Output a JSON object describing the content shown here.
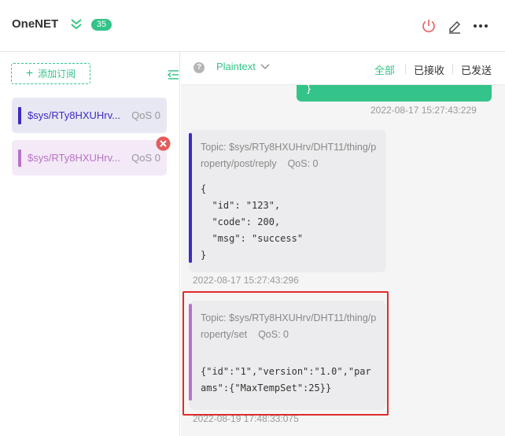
{
  "header": {
    "title": "OneNET",
    "connection_count": "35",
    "icons": [
      "collapse-icon",
      "power-icon",
      "edit-icon",
      "more-icon"
    ],
    "colors": {
      "accent": "#34c388",
      "danger": "#e55c5c"
    }
  },
  "sidebar": {
    "add_subscription_label": "添加订阅",
    "subscriptions": [
      {
        "topic": "$sys/RTy8HXUHrv...",
        "qos": "QoS 0",
        "color": "#3d2bc4"
      },
      {
        "topic": "$sys/RTy8HXUHrv...",
        "qos": "QoS 0",
        "color": "#b773c6"
      }
    ]
  },
  "toolbar": {
    "help": "?",
    "format": "Plaintext",
    "filters": {
      "all": "全部",
      "received": "已接收",
      "sent": "已发送"
    },
    "active_filter": "全部"
  },
  "messages": {
    "sent": {
      "payload": "}",
      "time": "2022-08-17 15:27:43:229"
    },
    "received": [
      {
        "topic": "Topic: $sys/RTy8HXUHrv/DHT11/thing/property/post/reply",
        "qos": "QoS: 0",
        "payload": "{\n  \"id\": \"123\",\n  \"code\": 200,\n  \"msg\": \"success\"\n}",
        "time": "2022-08-17 15:27:43:296",
        "color": "#3d2bc4"
      },
      {
        "topic": "Topic: $sys/RTy8HXUHrv/DHT11/thing/property/set",
        "qos": "QoS: 0",
        "payload": "{\"id\":\"1\",\"version\":\"1.0\",\"params\":{\"MaxTempSet\":25}}",
        "time": "2022-08-19 17:48:33:075",
        "color": "#b773c6"
      }
    ]
  }
}
